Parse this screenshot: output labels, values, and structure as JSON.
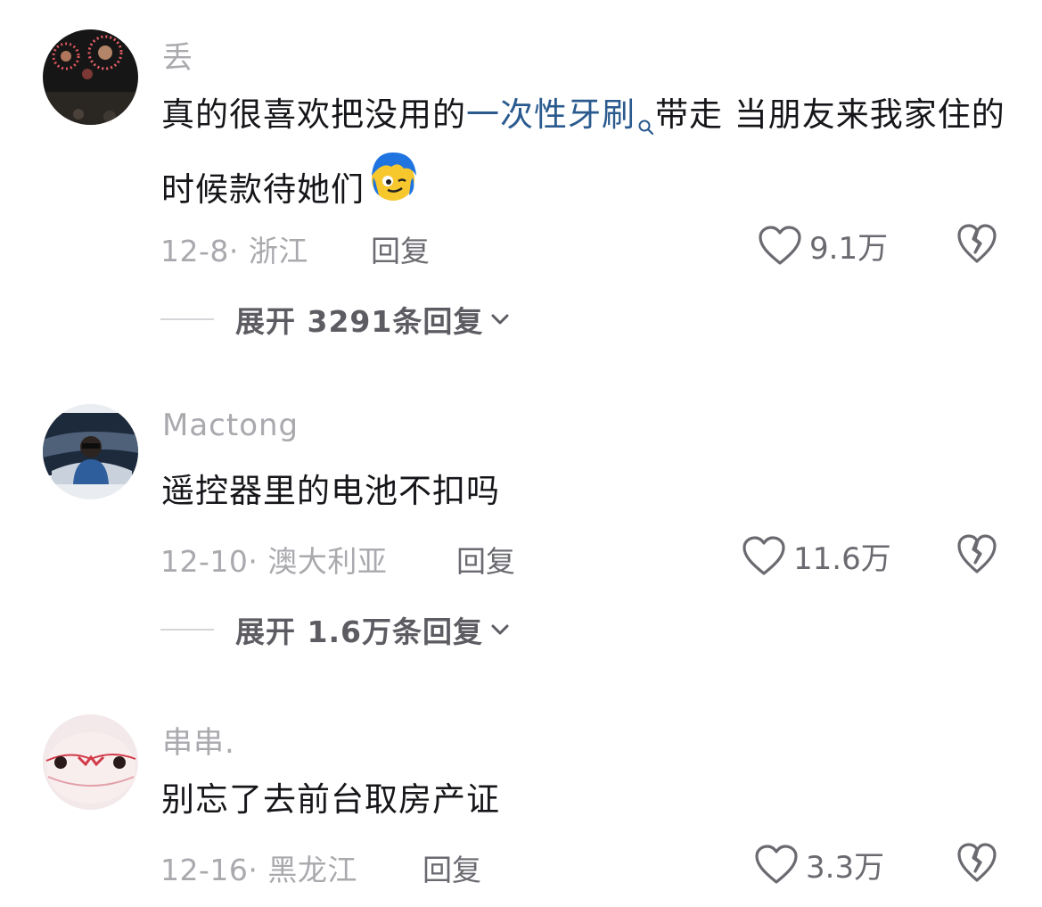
{
  "comments": [
    {
      "username": "丢",
      "text_before": "真的很喜欢把没用的",
      "link": "一次性牙刷",
      "text_after": "带走 当朋友来我家住的时候款待她们",
      "date": "12-8",
      "location": "浙江",
      "reply_label": "回复",
      "likes": "9.1万",
      "expand_label": "展开 3291条回复",
      "avatar_icon": "fireworks-avatar",
      "emoji_icon": "winking-face-emoji"
    },
    {
      "username": "Mactong",
      "text": "遥控器里的电池不扣吗",
      "date": "12-10",
      "location": "澳大利亚",
      "reply_label": "回复",
      "likes": "11.6万",
      "expand_label": "展开 1.6万条回复",
      "avatar_icon": "person-avatar"
    },
    {
      "username": "串串.",
      "text": "别忘了去前台取房产证",
      "date": "12-16",
      "location": "黑龙江",
      "reply_label": "回复",
      "likes": "3.3万",
      "avatar_icon": "plush-toy-avatar"
    }
  ],
  "colors": {
    "link": "#2a5a8e",
    "meta": "#a9a9ae",
    "text": "#16161a"
  }
}
